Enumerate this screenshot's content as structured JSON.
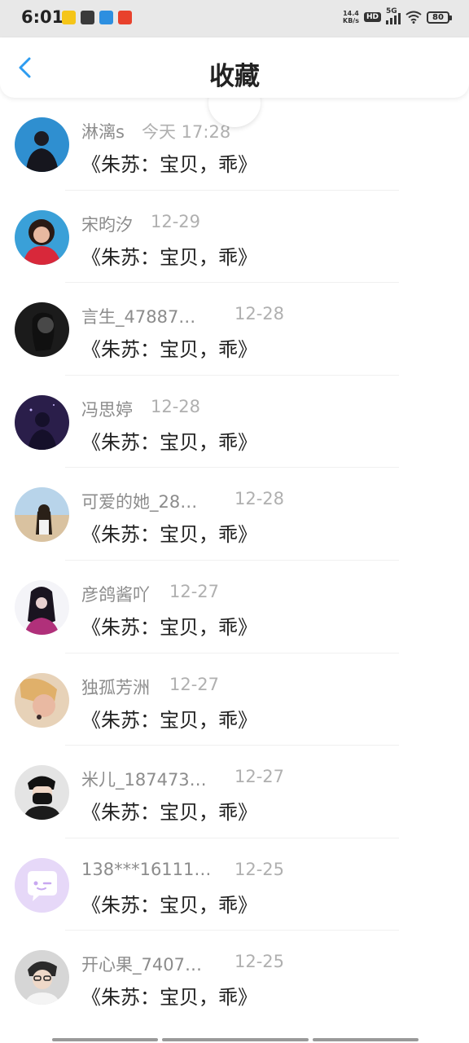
{
  "status_bar": {
    "time": "6:01",
    "net_speed_value": "14.4",
    "net_speed_unit": "KB/s",
    "hd": "HD",
    "network": "5G",
    "battery": "80"
  },
  "header": {
    "title": "收藏",
    "back_icon": "chevron-left-icon",
    "accent_color": "#2d9cf0"
  },
  "items": [
    {
      "name": "淋漓s",
      "date": "今天 17:28",
      "title": "《朱苏：宝贝，乖》"
    },
    {
      "name": "宋昀汐",
      "date": "12-29",
      "title": "《朱苏：宝贝，乖》"
    },
    {
      "name": "言生_47887…",
      "date": "12-28",
      "title": "《朱苏：宝贝，乖》"
    },
    {
      "name": "冯思婷",
      "date": "12-28",
      "title": "《朱苏：宝贝，乖》"
    },
    {
      "name": "可爱的她_28…",
      "date": "12-28",
      "title": "《朱苏：宝贝，乖》"
    },
    {
      "name": "彦鸽酱吖",
      "date": "12-27",
      "title": "《朱苏：宝贝，乖》"
    },
    {
      "name": "独孤芳洲",
      "date": "12-27",
      "title": "《朱苏：宝贝，乖》"
    },
    {
      "name": "米儿_187473…",
      "date": "12-27",
      "title": "《朱苏：宝贝，乖》"
    },
    {
      "name": "138***16111…",
      "date": "12-25",
      "title": "《朱苏：宝贝，乖》"
    },
    {
      "name": "开心果_7407…",
      "date": "12-25",
      "title": "《朱苏：宝贝，乖》"
    }
  ]
}
